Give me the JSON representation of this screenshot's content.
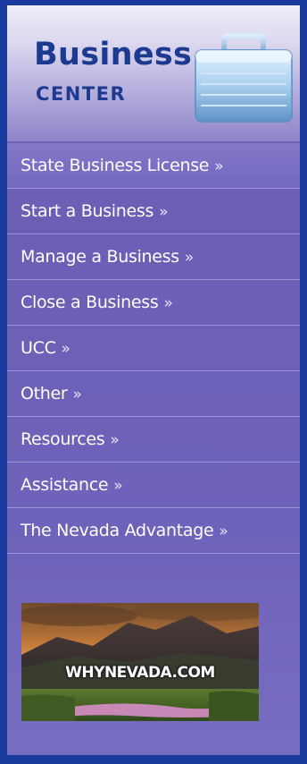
{
  "header": {
    "title": "Business",
    "subtitle": "CENTER",
    "icon": "briefcase-icon"
  },
  "menu": {
    "items": [
      {
        "label": "State Business License",
        "arrow": "»"
      },
      {
        "label": "Start a Business",
        "arrow": "»"
      },
      {
        "label": "Manage a Business",
        "arrow": "»"
      },
      {
        "label": "Close a Business",
        "arrow": "»"
      },
      {
        "label": "UCC",
        "arrow": "»"
      },
      {
        "label": "Other",
        "arrow": "»"
      },
      {
        "label": "Resources",
        "arrow": "»"
      },
      {
        "label": "Assistance",
        "arrow": "»"
      },
      {
        "label": "The Nevada Advantage",
        "arrow": "»"
      }
    ]
  },
  "banner": {
    "text": "WHYNEVADA.COM"
  },
  "colors": {
    "page_background": "#1a3a9e",
    "panel": "#6b5fb5",
    "title_text": "#1c3a8f",
    "menu_text": "#ffffff",
    "divider": "#9d94d6"
  }
}
